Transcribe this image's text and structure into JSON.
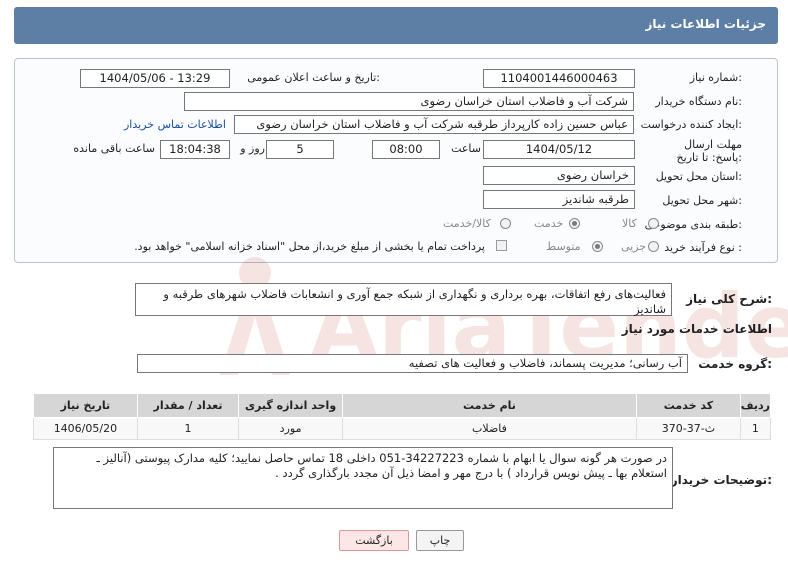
{
  "header": {
    "title": "جزئیات اطلاعات نیاز"
  },
  "labels": {
    "need_number": "شماره نیاز:",
    "announce_datetime": "تاریخ و ساعت اعلان عمومی:",
    "buyer_org": "نام دستگاه خریدار:",
    "requester": "ایجاد کننده درخواست:",
    "deadline": "مهلت ارسال پاسخ: تا تاریخ:",
    "hour": "ساعت",
    "day_and": "روز و",
    "remaining": "ساعت باقی مانده",
    "province": "استان محل تحویل:",
    "city": "شهر محل تحویل:",
    "category": "طبقه بندی موضوعی:",
    "process_type": "نوع فرآیند خرید :",
    "need_desc": "شرح کلی نیاز:",
    "services_info": "اطلاعات خدمات مورد نیاز",
    "service_group": "گروه خدمت:",
    "buyer_notes": "توضیحات خریدار:"
  },
  "values": {
    "need_number": "1104001446000463",
    "announce_datetime": "1404/05/06 - 13:29",
    "buyer_org": "شرکت آب و فاضلاب استان خراسان رضوی",
    "requester": "عباس حسین زاده کارپرداز طرقبه  شرکت آب و فاضلاب استان خراسان رضوی",
    "buyer_contact_link": "اطلاعات تماس خریدار",
    "deadline_date": "1404/05/12",
    "deadline_time": "08:00",
    "days": "5",
    "remaining_time": "18:04:38",
    "province": "خراسان رضوی",
    "city": "طرقبه شاندیز",
    "need_desc": "فعالیت‌های رفع اتفاقات، بهره برداری و نگهداری از شبکه جمع آوری و انشعابات فاضلاب شهرهای طرقبه و شاندیز",
    "service_group": "آب رسانی؛ مدیریت پسماند، فاضلاب و فعالیت های تصفیه",
    "buyer_notes": "در صورت هر گونه سوال یا ابهام با شماره 34227223-051 داخلی  18  تماس حاصل نمایید؛ کلیه مدارک پیوستی (آنالیز ـ استعلام بها ـ پیش نویس قرارداد ) با درج مهر و امضا ذیل آن مجدد بارگذاری گردد ."
  },
  "category_options": [
    {
      "label": "کالا",
      "selected": false
    },
    {
      "label": "خدمت",
      "selected": true
    },
    {
      "label": "کالا/خدمت",
      "selected": false
    }
  ],
  "process_options": [
    {
      "label": "جزیی",
      "selected": false
    },
    {
      "label": "متوسط",
      "selected": true
    }
  ],
  "treasury_note": "پرداخت تمام یا بخشی از مبلغ خرید،از محل \"اسناد خزانه اسلامی\" خواهد بود.",
  "table": {
    "headers": [
      "ردیف",
      "کد خدمت",
      "نام خدمت",
      "واحد اندازه گیری",
      "تعداد / مقدار",
      "تاریخ نیاز"
    ],
    "rows": [
      [
        "1",
        "ث-37-370",
        "فاضلاب",
        "مورد",
        "1",
        "1406/05/20"
      ]
    ]
  },
  "buttons": {
    "print": "چاپ",
    "back": "بازگشت"
  },
  "watermark": {
    "text": "AriaTender.neT"
  }
}
